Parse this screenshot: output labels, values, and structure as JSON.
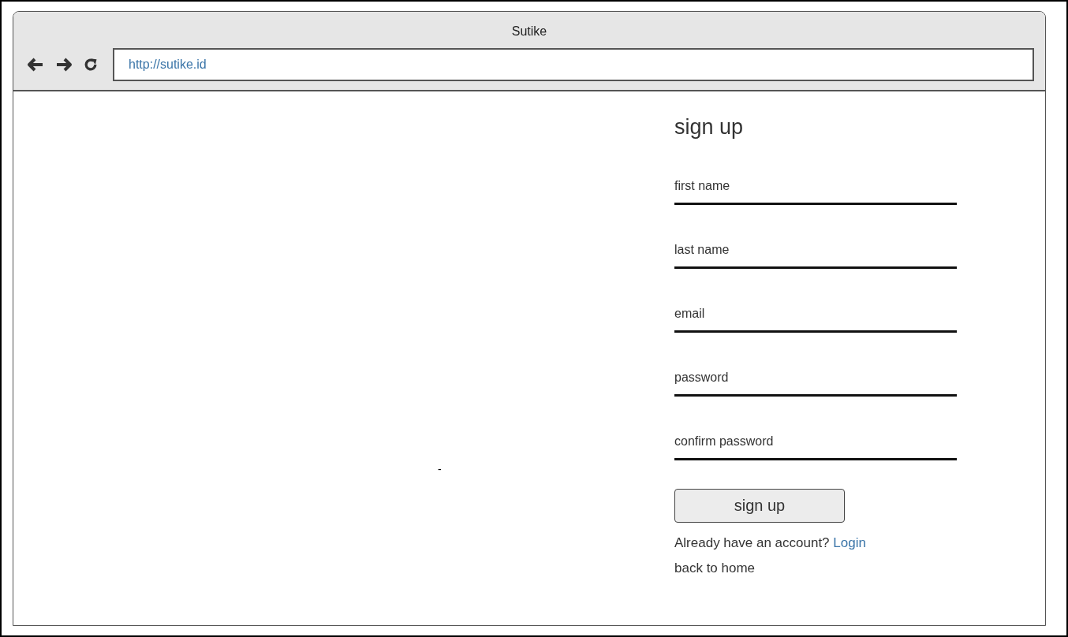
{
  "window": {
    "title": "Sutike"
  },
  "address_bar": {
    "url": "http://sutike.id"
  },
  "stray_mark": "-",
  "form": {
    "heading": "sign up",
    "fields": [
      {
        "placeholder": "first name"
      },
      {
        "placeholder": "last name"
      },
      {
        "placeholder": "email"
      },
      {
        "placeholder": "password"
      },
      {
        "placeholder": "confirm password"
      }
    ],
    "button": "sign up",
    "login_prompt": {
      "text": "Already have an account?",
      "link": "Login"
    },
    "back_link": "back to home"
  }
}
